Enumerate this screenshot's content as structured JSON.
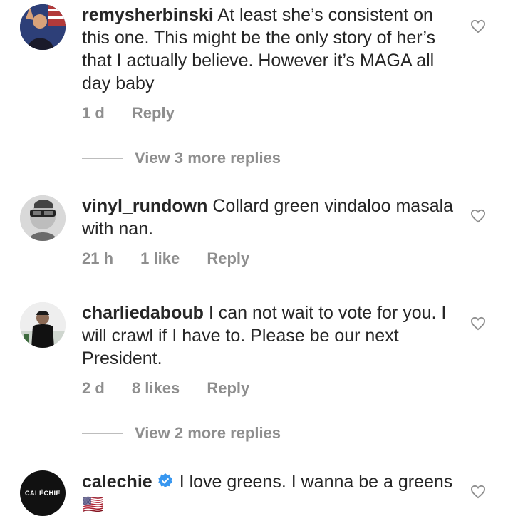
{
  "comments": [
    {
      "username": "remysherbinski",
      "text": "At least she’s consistent on this one. This might be the only story of her’s that I actually believe. However it’s MAGA all day baby",
      "time": "1 d",
      "likes": "",
      "reply": "Reply",
      "view_replies": "View 3 more replies"
    },
    {
      "username": "vinyl_rundown",
      "text": "Collard green vindaloo masala with nan.",
      "time": "21 h",
      "likes": "1 like",
      "reply": "Reply",
      "view_replies": ""
    },
    {
      "username": "charliedaboub",
      "text": "I can not wait to vote for you. I will crawl if I have to. Please be our next President.",
      "time": "2 d",
      "likes": "8 likes",
      "reply": "Reply",
      "view_replies": "View 2 more replies"
    },
    {
      "username": "calechie",
      "text": "I love greens. I wanna be a greens 🇺🇸",
      "verified": true,
      "avatar_text": "CALÉCHIE"
    }
  ],
  "icons": {
    "like": "heart-icon",
    "verified": "verified-badge-icon"
  },
  "colors": {
    "text": "#262626",
    "secondary": "#8e8e8e",
    "verified": "#3897f0"
  }
}
